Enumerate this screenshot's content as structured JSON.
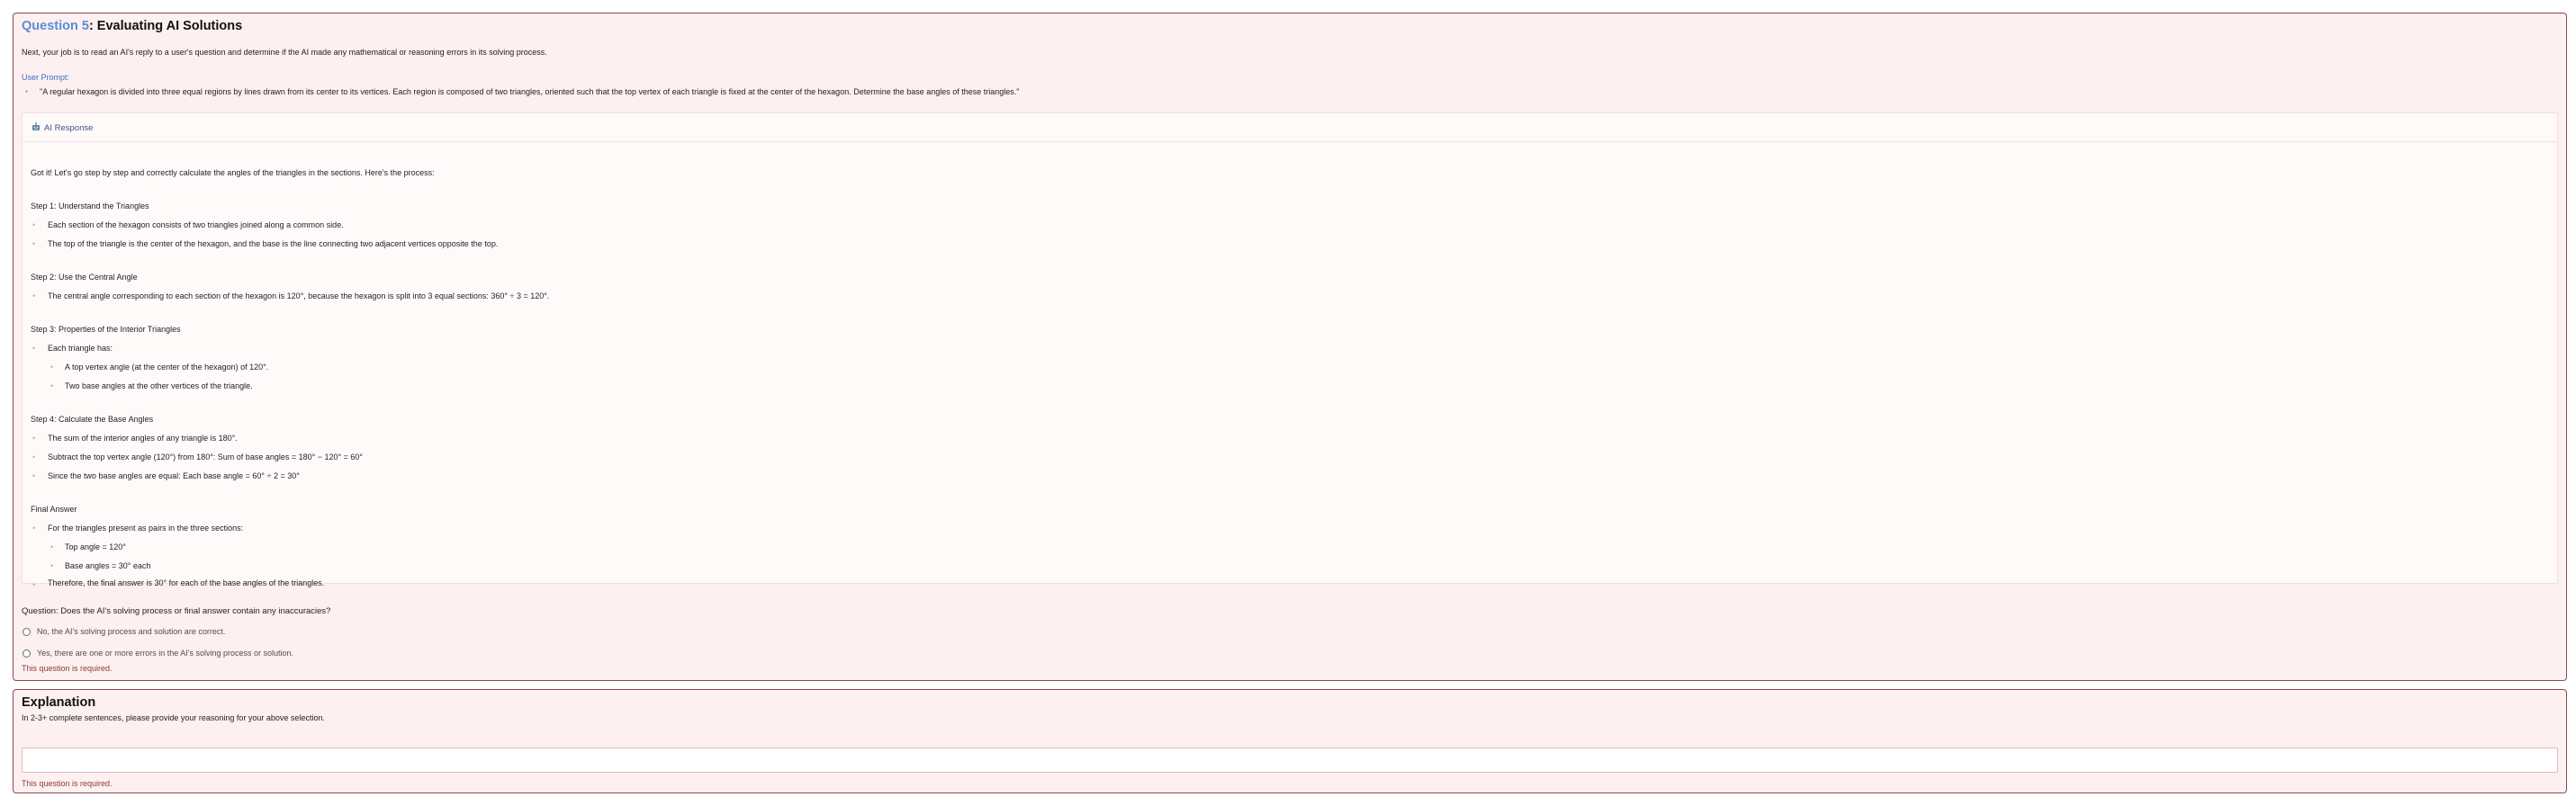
{
  "question": {
    "number_label": "Question 5",
    "title_rest": ": Evaluating AI Solutions",
    "intro": "Next, your job is to read an AI's reply to a user's question and determine if the AI made any mathematical or reasoning errors in its solving process.",
    "user_prompt_label": "User Prompt:",
    "user_prompt_text": "\"A regular hexagon is divided into three equal regions by lines drawn from its center to its vertices. Each region is composed of two triangles, oriented such that the top vertex of each triangle is fixed at the center of the hexagon. Determine the base angles of these triangles.\""
  },
  "ai_response": {
    "header": "AI Response",
    "icon": "robot-icon",
    "intro": "Got it! Let's go step by step and correctly calculate the angles of the triangles in the sections. Here's the process:",
    "step1_heading": "Step 1: Understand the Triangles",
    "step1_items": [
      "Each section of the hexagon consists of two triangles joined along a common side.",
      "The top of the triangle is the center of the hexagon, and the base is the line connecting two adjacent vertices opposite the top."
    ],
    "step2_heading": "Step 2: Use the Central Angle",
    "step2_items": [
      "The central angle corresponding to each section of the hexagon is 120°, because the hexagon is split into 3 equal sections: 360° ÷ 3 = 120°."
    ],
    "step3_heading": "Step 3: Properties of the Interior Triangles",
    "step3_item": "Each triangle has:",
    "step3_subitems": [
      "A top vertex angle (at the center of the hexagon) of 120°.",
      "Two base angles at the other vertices of the triangle."
    ],
    "step4_heading": "Step 4: Calculate the Base Angles",
    "step4_items": [
      "The sum of the interior angles of any triangle is 180°.",
      "Subtract the top vertex angle (120°) from 180°: Sum of base angles = 180° − 120° = 60°",
      "Since the two base angles are equal: Each base angle = 60° ÷ 2 = 30°"
    ],
    "final_heading": "Final Answer",
    "final_item": "For the triangles present as pairs in the three sections:",
    "final_subitems": [
      "Top angle = 120°",
      "Base angles = 30° each"
    ],
    "final_conclusion": "Therefore, the final answer is 30° for each of the base angles of the triangles."
  },
  "choice": {
    "prompt": "Question: Does the AI's solving process or final answer contain any inaccuracies?",
    "options": [
      "No, the AI's solving process and solution are correct.",
      "Yes, there are one or more errors in the AI's solving process or solution."
    ],
    "required_msg": "This question is required."
  },
  "explanation": {
    "title": "Explanation",
    "subtitle": "In 2-3+ complete sentences, please provide your reasoning for your above selection.",
    "input_value": "",
    "required_msg": "This question is required."
  },
  "colors": {
    "card_bg": "#fdf0f0",
    "card_border": "#8c4a4a",
    "link_blue": "#5b8dd6",
    "required_red": "#8b3a3a"
  }
}
